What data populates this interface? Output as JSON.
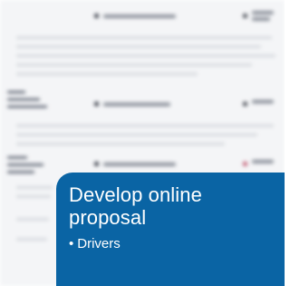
{
  "panel": {
    "title": "Develop online proposal",
    "bullets": [
      "Drivers"
    ],
    "background": "#0a64a4"
  },
  "document": {
    "note": "background document is blurred and unreadable"
  }
}
